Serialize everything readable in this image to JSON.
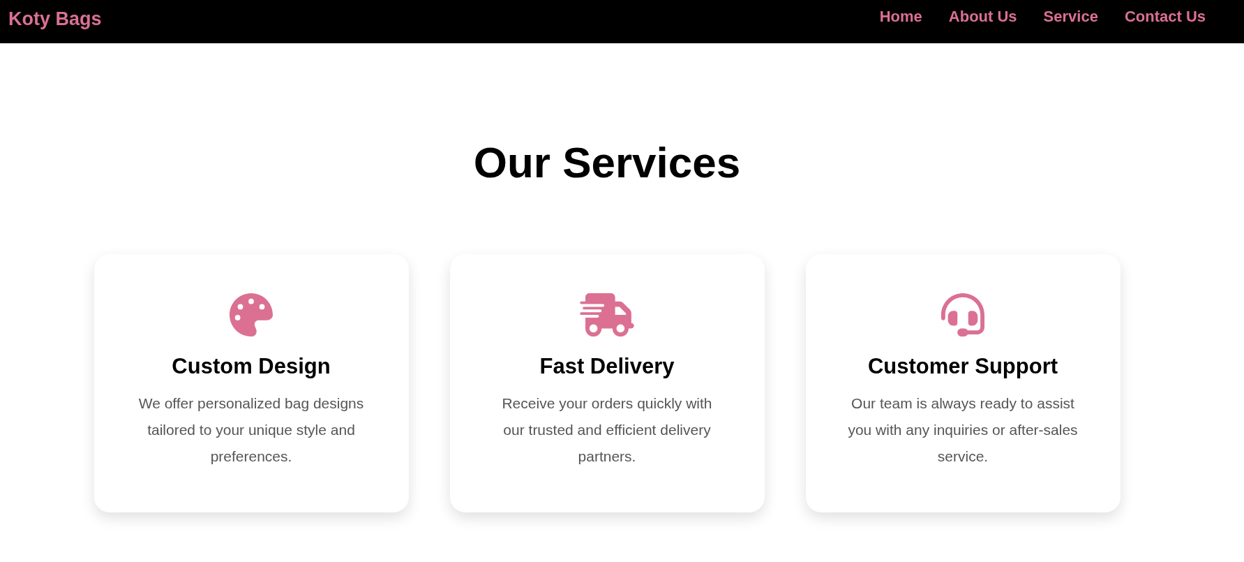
{
  "navbar": {
    "logo": "Koty Bags",
    "links": [
      "Home",
      "About Us",
      "Service",
      "Contact Us"
    ]
  },
  "section": {
    "title": "Our Services",
    "cards": [
      {
        "kind": "palette",
        "title": "Custom Design",
        "text": "We offer personalized bag designs tailored to your unique style and preferences."
      },
      {
        "kind": "truck",
        "title": "Fast Delivery",
        "text": "Receive your orders quickly with our trusted and efficient delivery partners."
      },
      {
        "kind": "headset",
        "title": "Customer Support",
        "text": "Our team is always ready to assist you with any inquiries or after-sales service."
      }
    ]
  }
}
